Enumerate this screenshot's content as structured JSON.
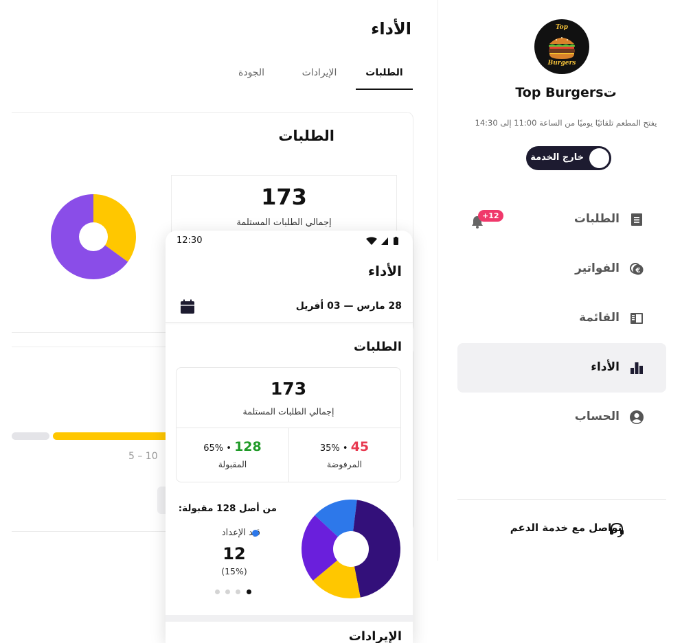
{
  "desktop": {
    "page_title": "الأداء",
    "tabs": [
      {
        "label": "الطلبات",
        "active": true
      },
      {
        "label": "الإيرادات",
        "active": false
      },
      {
        "label": "الجودة",
        "active": false
      }
    ],
    "orders_card": {
      "title": "الطلبات",
      "total": "173",
      "total_label": "إجمالي الطلبات المستلمة"
    },
    "range_label": "5 – 10",
    "colors": {
      "accent_yellow": "#ffc700",
      "purple": "#8a4de8"
    }
  },
  "sidebar": {
    "logo": {
      "line1": "Top",
      "line2": "Burgers"
    },
    "restaurant_name": "Top Burgersت",
    "hours": "يفتح المطعم تلقائيًا يوميًا من الساعة 11:00 إلى 14:30",
    "status_toggle": "خارج الخدمة",
    "nav": [
      {
        "label": "الطلبات",
        "icon": "document-icon",
        "badge": "+12"
      },
      {
        "label": "الفواتير",
        "icon": "euro-coin-icon"
      },
      {
        "label": "القائمة",
        "icon": "menu-book-icon"
      },
      {
        "label": "الأداء",
        "icon": "bar-chart-icon",
        "active": true
      },
      {
        "label": "الحساب",
        "icon": "user-circle-icon"
      }
    ],
    "support": "تواصل مع خدمة الدعم"
  },
  "phone": {
    "time": "12:30",
    "title": "الأداء",
    "date_range": "28 مارس — 03 أفريل",
    "section_title": "الطلبات",
    "total": "173",
    "total_label": "إجمالي الطلبات المستلمة",
    "accepted": {
      "value": "128",
      "pct": "65% •",
      "label": "المقبولة"
    },
    "rejected": {
      "value": "45",
      "pct": "35% •",
      "label": "المرفوضة"
    },
    "of_accepted": "من أصل 128 مقبولة:",
    "legend_label": "قيد الإعداد",
    "count": "12",
    "count_pct": "(15%)",
    "next_section_title": "الإيرادات",
    "colors": {
      "green": "#1f9a27",
      "red": "#e8384f",
      "blue": "#2d78ea",
      "navy": "#33107a",
      "yellow": "#ffc700",
      "violet": "#6a1fdc"
    }
  },
  "chart_data": [
    {
      "type": "pie",
      "title": "",
      "categories": [
        "",
        ""
      ],
      "values": [
        35,
        65
      ],
      "colors": [
        "#ffc700",
        "#8a4de8"
      ]
    },
    {
      "type": "pie",
      "title": "",
      "categories": [
        "قيد الإعداد",
        "",
        "",
        ""
      ],
      "values": [
        15,
        45,
        17,
        23
      ],
      "colors": [
        "#2d78ea",
        "#33107a",
        "#ffc700",
        "#6a1fdc"
      ]
    }
  ]
}
